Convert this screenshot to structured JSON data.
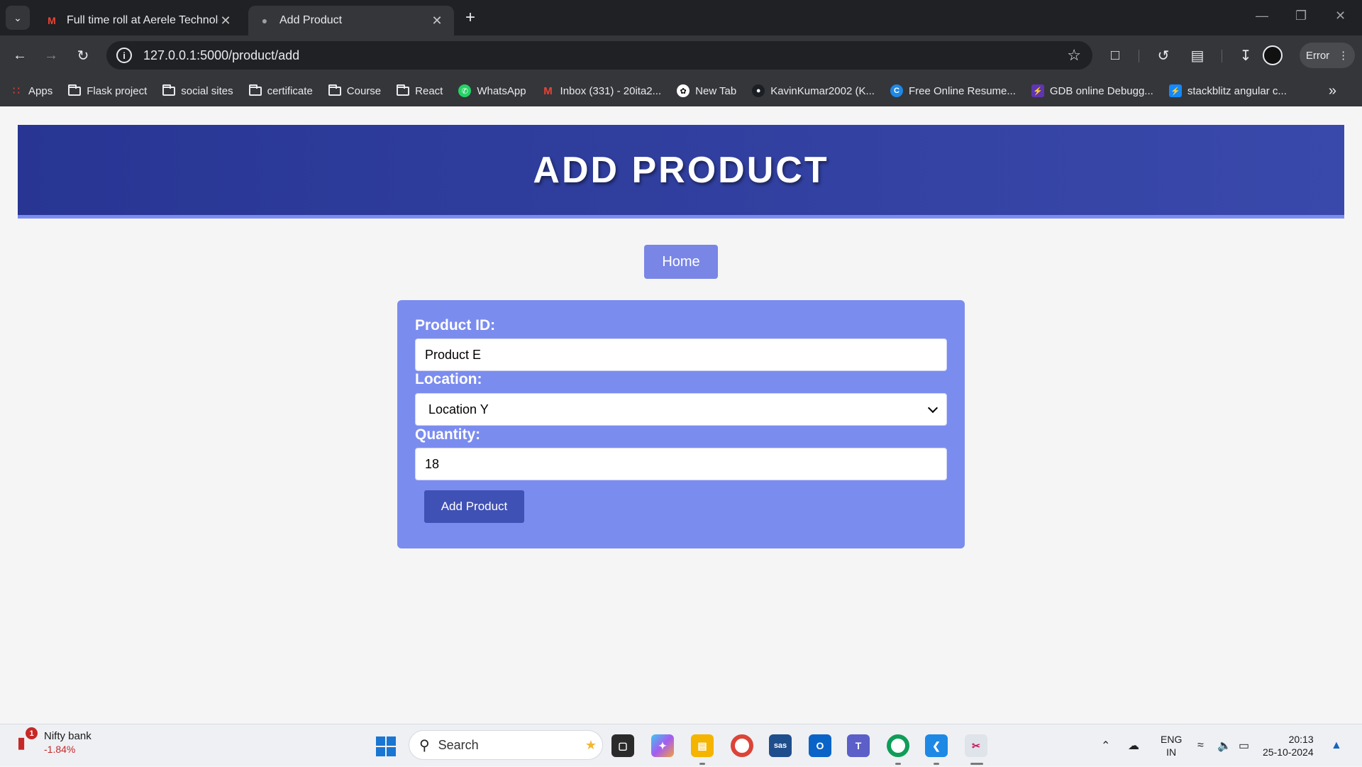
{
  "browser": {
    "tabs": [
      {
        "title": "Full time roll at Aerele Technolo",
        "favicon": "gmail-icon"
      },
      {
        "title": "Add Product",
        "favicon": "globe-icon"
      }
    ],
    "url": "127.0.0.1:5000/product/add",
    "profile_status": "Error",
    "bookmarks": [
      {
        "label": "Apps",
        "icon": "apps-grid-icon"
      },
      {
        "label": "Flask project",
        "icon": "folder-icon"
      },
      {
        "label": "social sites",
        "icon": "folder-icon"
      },
      {
        "label": "certificate",
        "icon": "folder-icon"
      },
      {
        "label": "Course",
        "icon": "folder-icon"
      },
      {
        "label": "React",
        "icon": "folder-icon"
      },
      {
        "label": "WhatsApp",
        "icon": "whatsapp-icon"
      },
      {
        "label": "Inbox (331) - 20ita2...",
        "icon": "gmail-icon"
      },
      {
        "label": "New Tab",
        "icon": "chatgpt-icon"
      },
      {
        "label": "KavinKumar2002 (K...",
        "icon": "github-icon"
      },
      {
        "label": "Free Online Resume...",
        "icon": "resume-icon"
      },
      {
        "label": "GDB online Debugg...",
        "icon": "gdb-icon"
      },
      {
        "label": "stackblitz angular c...",
        "icon": "stackblitz-icon"
      }
    ]
  },
  "page": {
    "heading": "ADD PRODUCT",
    "home_label": "Home",
    "form": {
      "product_id_label": "Product ID:",
      "product_id_value": "Product E",
      "location_label": "Location:",
      "location_value": "Location Y",
      "quantity_label": "Quantity:",
      "quantity_value": "18",
      "submit_label": "Add Product"
    },
    "colors": {
      "header": "#303f9f",
      "card": "#7b8cef",
      "submit": "#3f51b5",
      "home": "#7986e6"
    }
  },
  "taskbar": {
    "stock_name": "Nifty bank",
    "stock_change": "-1.84%",
    "stock_badge": "1",
    "search_placeholder": "Search",
    "lang_line1": "ENG",
    "lang_line2": "IN",
    "time": "20:13",
    "date": "25-10-2024"
  }
}
